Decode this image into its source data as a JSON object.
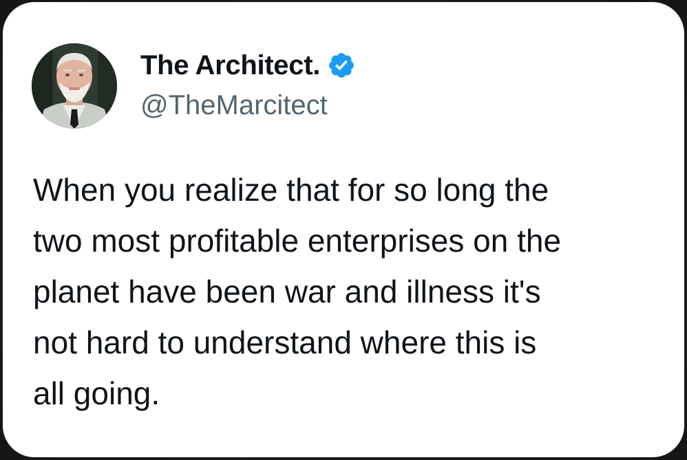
{
  "tweet": {
    "author": {
      "display_name": "The Architect.",
      "handle": "@TheMarcitect",
      "verified": true,
      "verified_icon": "verified-badge-icon",
      "verified_color": "#1d9bf0"
    },
    "text_lines": [
      "When you realize that for so long the",
      "two most profitable enterprises on the",
      "planet have been war and illness it's",
      "not hard to understand where this is",
      "all going."
    ]
  },
  "colors": {
    "card_background": "#ffffff",
    "primary_text": "#0f1419",
    "secondary_text": "#536471",
    "page_background": "#1f1f1f"
  }
}
